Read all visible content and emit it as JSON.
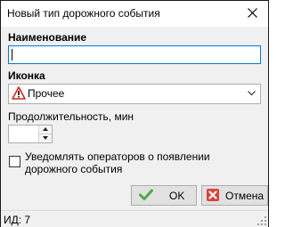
{
  "window": {
    "title": "Новый тип дорожного события"
  },
  "form": {
    "name_label": "Наименование",
    "name_value": "",
    "icon_label": "Иконка",
    "icon_value": "Прочее",
    "duration_label": "Продолжительность, мин",
    "duration_value": "",
    "notify_label": "Уведомлять операторов о появлении дорожного события",
    "notify_checked": false
  },
  "buttons": {
    "ok_label": "OK",
    "cancel_label": "Отмена"
  },
  "status": {
    "text": "ИД: 7"
  },
  "icons": {
    "close": "close-icon",
    "warning": "warning-icon",
    "chevron": "chevron-down-icon",
    "ok": "checkmark-icon",
    "cancel": "cancel-icon"
  },
  "colors": {
    "focus_border": "#0078d7",
    "ok_check": "#4caf3e",
    "cancel_bg": "#d9453a",
    "warning_red": "#d42020"
  }
}
